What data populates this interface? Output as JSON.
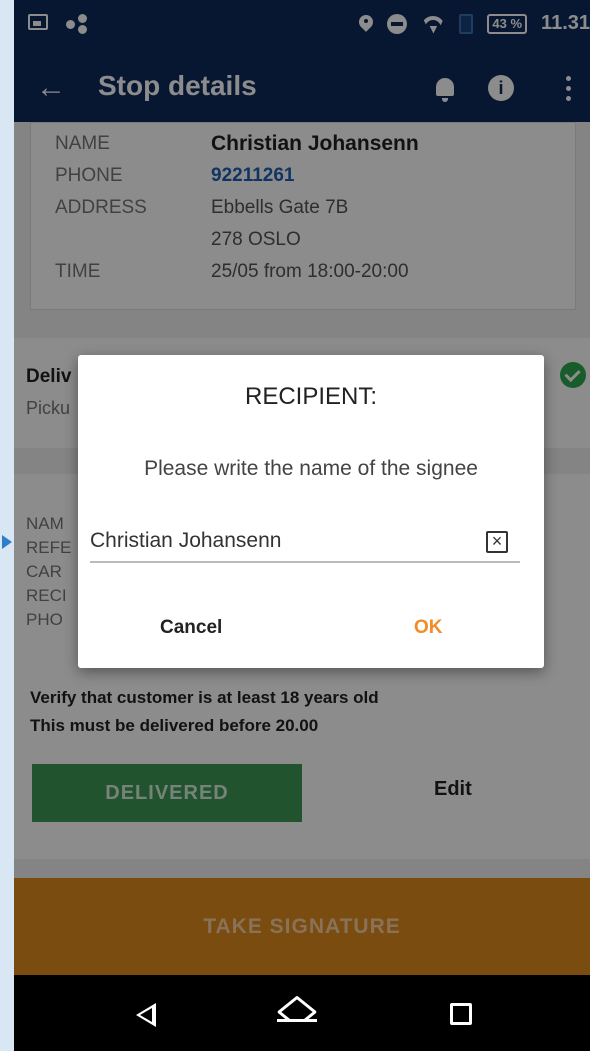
{
  "status_bar": {
    "battery": "43 %",
    "time": "11.31"
  },
  "app_bar": {
    "title": "Stop details",
    "icons": [
      "back-arrow-icon",
      "bell-icon",
      "info-icon",
      "more-vert-icon"
    ]
  },
  "customer": {
    "name_label": "NAME",
    "name": "Christian Johansenn",
    "phone_label": "PHONE",
    "phone": "92211261",
    "address_label": "ADDRESS",
    "address_line1": "Ebbells Gate 7B",
    "address_line2": "278 OSLO",
    "time_label": "TIME",
    "time": "25/05 from 18:00-20:00"
  },
  "delivery": {
    "title": "Deliv",
    "subtitle": "Picku"
  },
  "details": {
    "labels": [
      "NAM",
      "REFE",
      "CAR",
      "RECI",
      "PHO"
    ],
    "notes": [
      "Verify that customer is at least 18 years old",
      "This must be delivered before 20.00"
    ],
    "delivered_label": "DELIVERED",
    "edit_label": "Edit"
  },
  "take_signature_label": "TAKE SIGNATURE",
  "dialog": {
    "title": "RECIPIENT:",
    "message": "Please write the name of the signee",
    "input_value": "Christian Johansenn",
    "cancel_label": "Cancel",
    "ok_label": "OK"
  },
  "colors": {
    "app_bar": "#0d2a5c",
    "accent_orange": "#f28c28",
    "delivered_green": "#3d9a55",
    "signature_button": "#e08a1e"
  }
}
